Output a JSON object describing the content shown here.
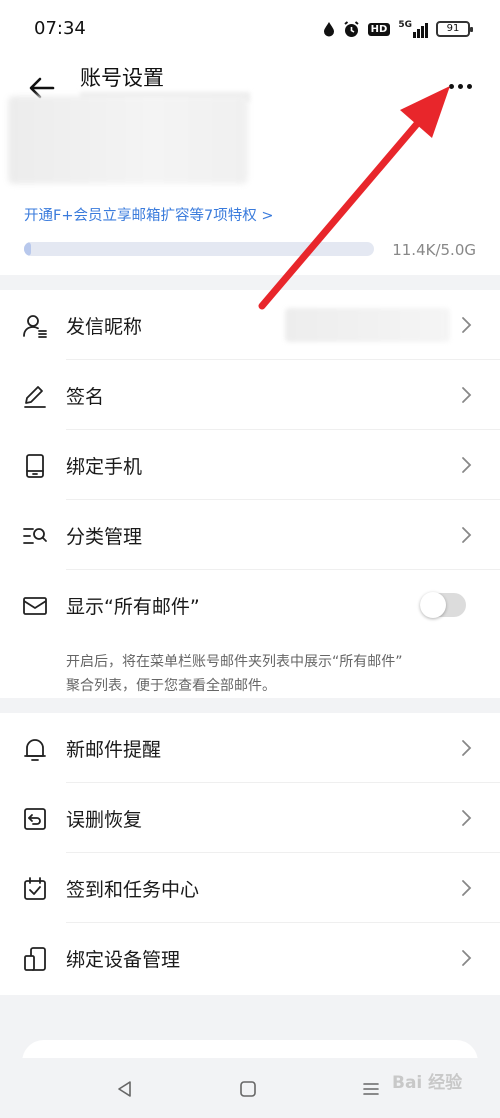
{
  "status_bar": {
    "time": "07:34",
    "network": "5G",
    "battery": "91",
    "icons": [
      "water-drop-icon",
      "alarm-icon",
      "hd-icon",
      "signal-icon",
      "battery-icon"
    ]
  },
  "header": {
    "title": "账号设置",
    "back_icon": "back-arrow-icon",
    "more_icon": "more-dots-icon"
  },
  "account": {
    "vip_link": "开通F+会员立享邮箱扩容等7项特权 >",
    "storage_text": "11.4K/5.0G",
    "storage_used_fraction": 0.002
  },
  "settings": {
    "nickname_label": "发信昵称",
    "signature_label": "签名",
    "bind_phone_label": "绑定手机",
    "category_label": "分类管理",
    "show_all_mail_label": "显示“所有邮件”",
    "show_all_mail_enabled": false,
    "show_all_mail_desc_line1": "开启后，将在菜单栏账号邮件夹列表中展示“所有邮件”",
    "show_all_mail_desc_line2": "聚合列表，便于您查看全部邮件。"
  },
  "settings2": {
    "new_mail_alert_label": "新邮件提醒",
    "recovery_label": "误删恢复",
    "checkin_label": "签到和任务中心",
    "device_label": "绑定设备管理"
  },
  "nav": {
    "icons": [
      "back-triangle-icon",
      "home-square-icon",
      "menu-lines-icon"
    ]
  },
  "watermark": "Bai 经验",
  "annotation_color": "#e8262b"
}
